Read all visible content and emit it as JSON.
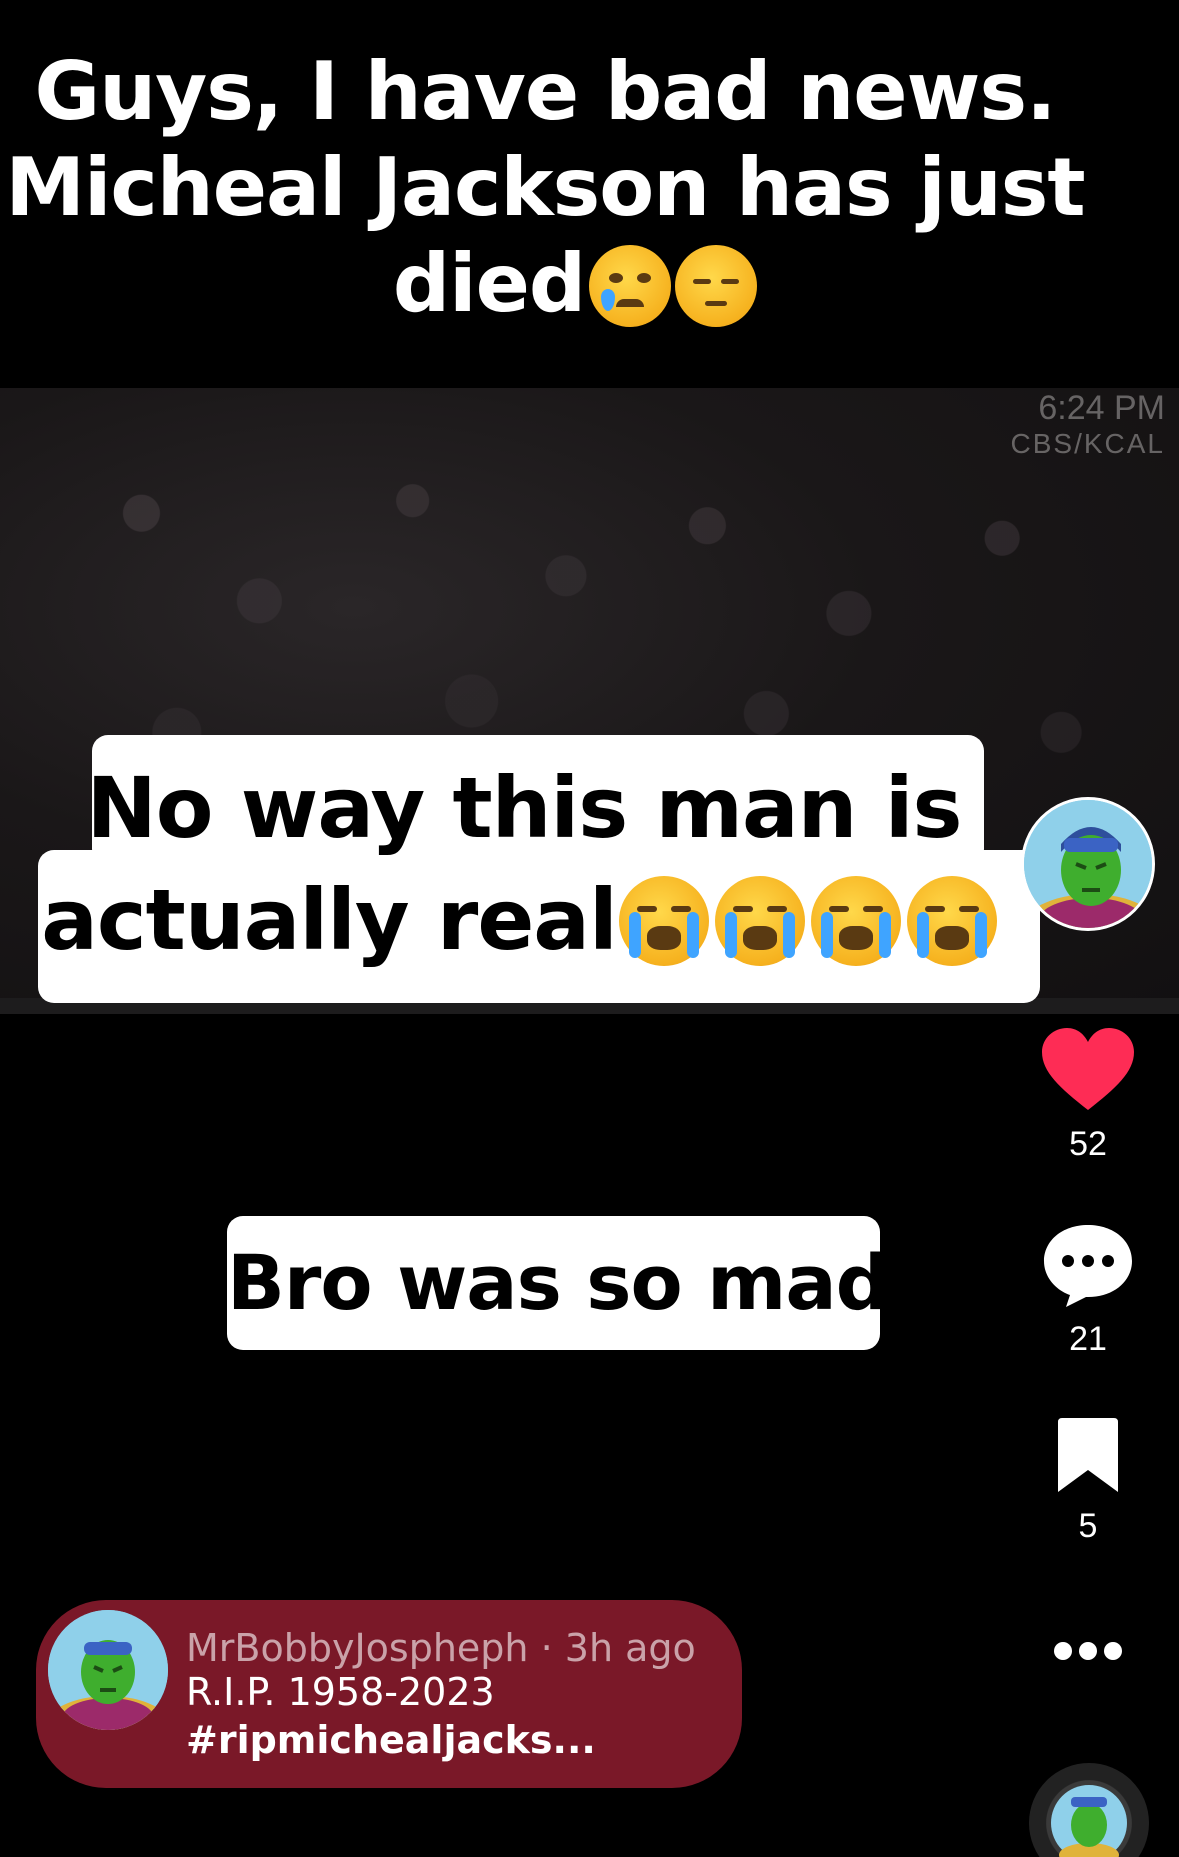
{
  "headline": {
    "line1": "Guys, I have bad news.",
    "line2": "Micheal Jackson has just",
    "line3": "died"
  },
  "video": {
    "time_stamp": "6:24 PM",
    "network": "CBS/KCAL"
  },
  "captions": {
    "bubble1_line1": "No way this man is",
    "bubble1_line2": "actually real",
    "bubble2": "Bro was so mad"
  },
  "actions": {
    "likes": "52",
    "comments": "21",
    "saves": "5",
    "like_color": "#fe2c55"
  },
  "post": {
    "username": "MrBobbyJospheph",
    "separator": " · ",
    "time_ago": "3h ago",
    "description": "R.I.P. 1958-2023",
    "hashtag": "#ripmichealjacks...",
    "card_color": "#7a1828"
  },
  "icons": [
    "crying-face-icon",
    "pensive-face-icon",
    "loudly-crying-face-icon",
    "heart-icon",
    "comment-icon",
    "bookmark-icon",
    "more-icon"
  ]
}
